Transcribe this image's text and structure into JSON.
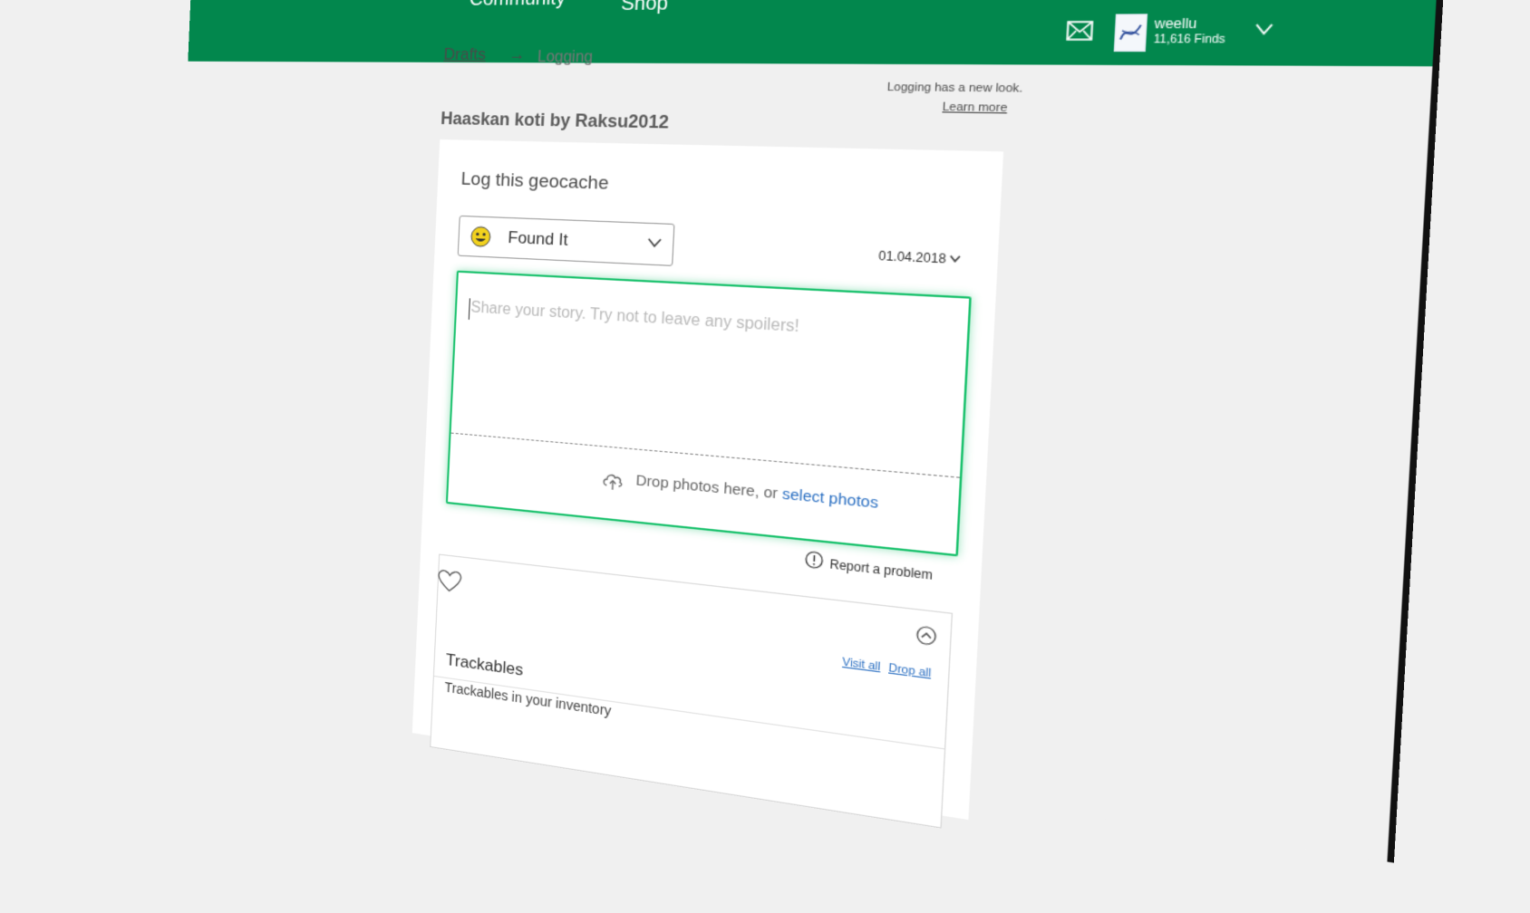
{
  "nav": {
    "community": "Community",
    "shop": "Shop"
  },
  "user": {
    "name": "weellu",
    "finds": "11,616 Finds"
  },
  "breadcrumb": {
    "drafts": "Drafts",
    "arrow": "→",
    "current": "Logging"
  },
  "notice": {
    "text": "Logging has a new look.",
    "link": "Learn more"
  },
  "cache": {
    "name": "Haaskan koti",
    "by": "by Raksu2012"
  },
  "form": {
    "heading": "Log this geocache",
    "log_type": "Found It",
    "date": "01.04.2018",
    "placeholder": "Share your story. Try not to leave any spoilers!",
    "drop_text": "Drop photos here, or ",
    "select_photos": "select photos",
    "report": "Report a problem"
  },
  "trackables": {
    "title": "Trackables",
    "subtitle": "Trackables in your inventory",
    "visit_all": "Visit all",
    "drop_all": "Drop all"
  },
  "colors": {
    "brand_green": "#02874d",
    "focus_green": "#19c16c",
    "link_blue": "#2a6fc2"
  },
  "icons": [
    "mail-icon",
    "chevron-down-icon",
    "smiley-icon",
    "upload-cloud-icon",
    "warning-icon",
    "heart-icon",
    "chevron-up-icon"
  ]
}
